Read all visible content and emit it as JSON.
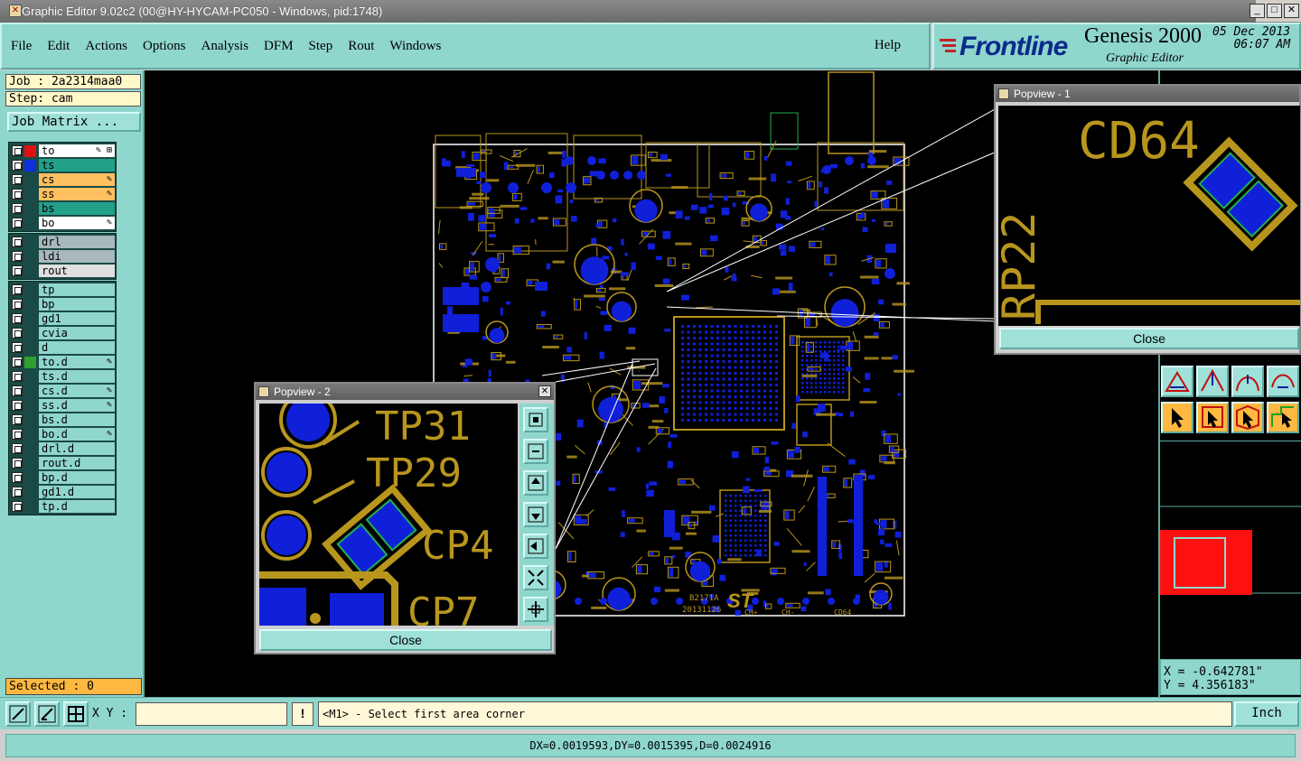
{
  "window": {
    "title": "Graphic Editor 9.02c2 (00@HY-HYCAM-PC050 - Windows, pid:1748)",
    "min": "_",
    "max": "□",
    "close": "✕"
  },
  "menu": {
    "items": [
      "File",
      "Edit",
      "Actions",
      "Options",
      "Analysis",
      "DFM",
      "Step",
      "Rout",
      "Windows"
    ],
    "help": "Help"
  },
  "brand": {
    "logo_a": "Fr",
    "logo_b": "ontline",
    "product": "Genesis 2000",
    "subtitle": "Graphic Editor",
    "date_line1": "05 Dec 2013",
    "date_line2": "06:07 AM"
  },
  "job": {
    "job_label": "Job : 2a2314maa0",
    "step_label": "Step: cam",
    "matrix_button": "Job Matrix ..."
  },
  "layers": {
    "board": [
      {
        "name": "to",
        "color": "#e01010",
        "bg": "#ffffff",
        "edit": "✎ ⊞"
      },
      {
        "name": "ts",
        "color": "#1030e0",
        "bg": "#22a08a",
        "edit": ""
      },
      {
        "name": "cs",
        "color": "",
        "bg": "#ffc060",
        "edit": "✎"
      },
      {
        "name": "ss",
        "color": "",
        "bg": "#ffc060",
        "edit": "✎"
      },
      {
        "name": "bs",
        "color": "",
        "bg": "#22a08a",
        "edit": ""
      },
      {
        "name": "bo",
        "color": "",
        "bg": "#ffffff",
        "edit": "✎"
      }
    ],
    "drill": [
      {
        "name": "drl",
        "bg": "#a8b8bc"
      },
      {
        "name": "ldi",
        "bg": "#a8b8bc"
      },
      {
        "name": "rout",
        "bg": "#e0e0e0"
      }
    ],
    "misc": [
      {
        "name": "tp",
        "color": "",
        "edit": ""
      },
      {
        "name": "bp",
        "color": "",
        "edit": ""
      },
      {
        "name": "gd1",
        "color": "",
        "edit": ""
      },
      {
        "name": "cvia",
        "color": "",
        "edit": ""
      },
      {
        "name": "d",
        "color": "",
        "edit": ""
      },
      {
        "name": "to.d",
        "color": "#30a030",
        "edit": "✎"
      },
      {
        "name": "ts.d",
        "color": "",
        "edit": ""
      },
      {
        "name": "cs.d",
        "color": "",
        "edit": "✎"
      },
      {
        "name": "ss.d",
        "color": "",
        "edit": "✎"
      },
      {
        "name": "bs.d",
        "color": "",
        "edit": ""
      },
      {
        "name": "bo.d",
        "color": "",
        "edit": "✎"
      },
      {
        "name": "drl.d",
        "color": "",
        "edit": ""
      },
      {
        "name": "rout.d",
        "color": "",
        "edit": ""
      },
      {
        "name": "bp.d",
        "color": "",
        "edit": ""
      },
      {
        "name": "gd1.d",
        "color": "",
        "edit": ""
      },
      {
        "name": "tp.d",
        "color": "",
        "edit": ""
      }
    ]
  },
  "selected": "Selected : 0",
  "board_labels": [
    "B2171A",
    "20131126",
    "ST",
    "CH+",
    "CH-",
    "CD64",
    "TP29",
    "CP4"
  ],
  "popview1": {
    "title": "Popview - 1",
    "label_a": "CD64",
    "label_b": "RP22",
    "close": "Close"
  },
  "popview2": {
    "title": "Popview - 2",
    "label_a": "TP31",
    "label_b": "TP29",
    "label_c": "CP4",
    "label_d": "CP7",
    "close": "Close"
  },
  "coords": {
    "x": "X = -0.642781\"",
    "y": "Y =  4.356183\""
  },
  "bottom": {
    "xy_label": "X Y :",
    "xy_value": "",
    "excl": "!",
    "prompt": "<M1> - Select first area corner",
    "units": "Inch"
  },
  "status": "DX=0.0019593,DY=0.0015395,D=0.0024916",
  "colors": {
    "accent": "#8fd6cd",
    "copper": "#b8961e",
    "pad": "#1020d8",
    "selected": "#ffb840"
  }
}
